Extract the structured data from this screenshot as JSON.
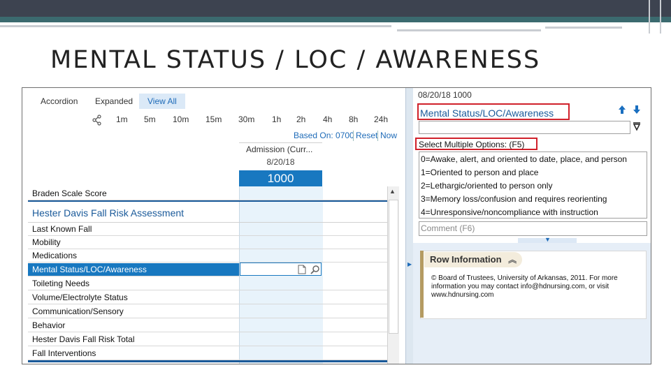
{
  "slide": {
    "title": "MENTAL STATUS / LOC / AWARENESS"
  },
  "view_tabs": [
    "Accordion",
    "Expanded",
    "View All"
  ],
  "time_buttons": [
    "1m",
    "5m",
    "10m",
    "15m",
    "30m",
    "1h",
    "2h",
    "4h",
    "8h",
    "24h"
  ],
  "based_on": {
    "label": "Based On: 0700",
    "reset": "Reset",
    "now": "Now"
  },
  "column": {
    "header": "Admission (Curr...",
    "date": "8/20/18",
    "time": "1000"
  },
  "rows": {
    "braden": "Braden Scale Score",
    "section": "Hester Davis Fall Risk Assessment",
    "items": [
      "Last Known Fall",
      "Mobility",
      "Medications",
      "Mental Status/LOC/Awareness",
      "Toileting Needs",
      "Volume/Electrolyte Status",
      "Communication/Sensory",
      "Behavior",
      "Hester Davis Fall Risk Total",
      "Fall Interventions"
    ],
    "selected_index": 3
  },
  "right_panel": {
    "datetime": "08/20/18 1000",
    "title": "Mental Status/LOC/Awareness",
    "select_label": "Select Multiple Options: (F5)",
    "options": [
      "0=Awake, alert, and oriented to date, place, and person",
      "1=Oriented to person and place",
      "2=Lethargic/oriented to person only",
      "3=Memory loss/confusion and requires reorienting",
      "4=Unresponsive/noncompliance with instruction"
    ],
    "comment_placeholder": "Comment (F6)",
    "row_info": {
      "title": "Row Information",
      "text": "© Board of Trustees, University of Arkansas, 2011. For more information you may contact info@hdnursing.com, or visit www.hdnursing.com"
    }
  },
  "colors": {
    "accent": "#1878c0",
    "highlight_box": "#d0202a",
    "title_text": "#1a5a9a"
  }
}
